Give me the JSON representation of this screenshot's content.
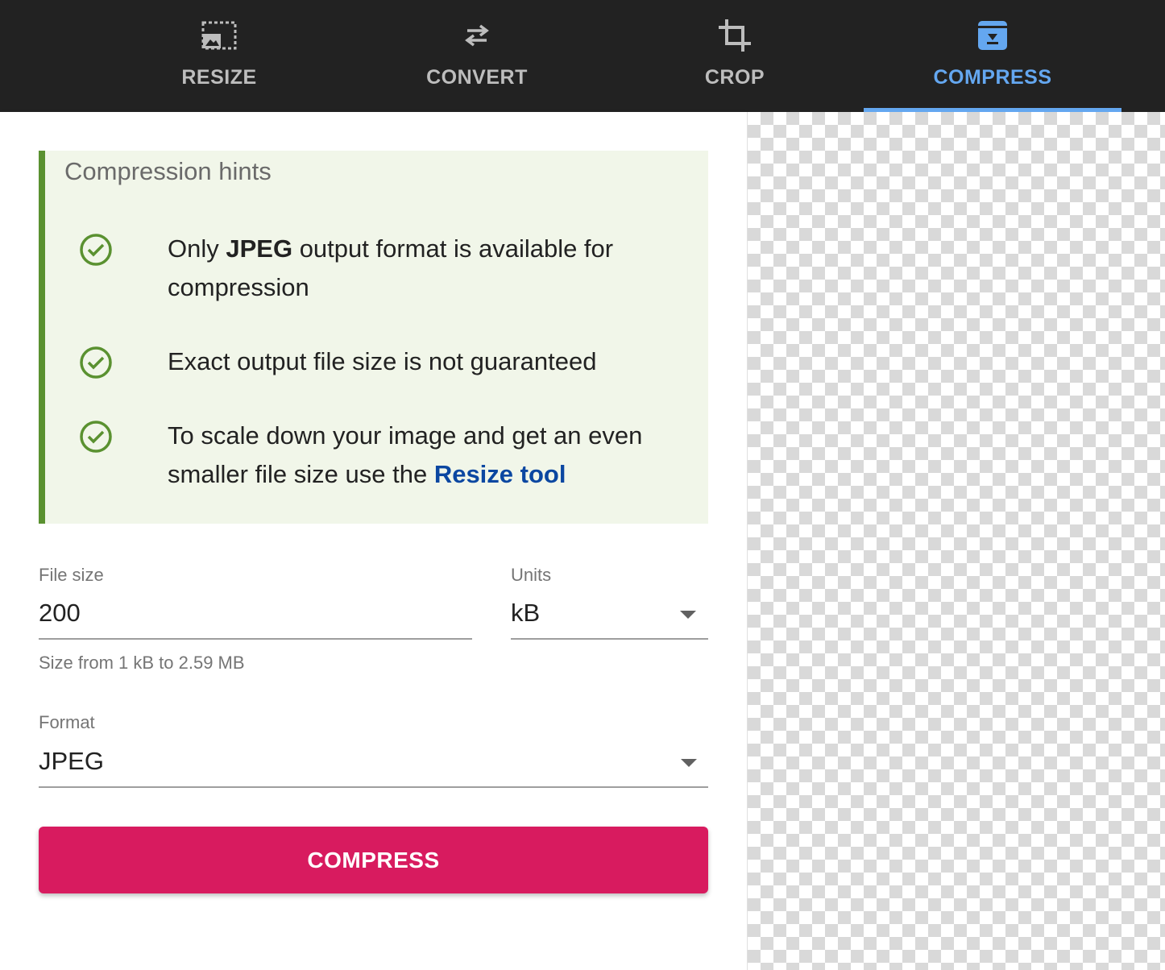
{
  "nav": {
    "tabs": [
      {
        "label": "RESIZE",
        "icon": "image-resize-icon",
        "active": false
      },
      {
        "label": "CONVERT",
        "icon": "swap-arrows-icon",
        "active": false
      },
      {
        "label": "CROP",
        "icon": "crop-icon",
        "active": false
      },
      {
        "label": "COMPRESS",
        "icon": "archive-download-icon",
        "active": true
      }
    ]
  },
  "hints": {
    "title": "Compression hints",
    "items": [
      {
        "icon": "check-circle-icon",
        "pre": "Only ",
        "bold": "JPEG",
        "post": " output format is available for compression"
      },
      {
        "icon": "check-circle-icon",
        "text": "Exact output file size is not guaranteed"
      },
      {
        "icon": "check-circle-icon",
        "pre": "To scale down your image and get an even smaller file size use the ",
        "link": "Resize tool"
      }
    ]
  },
  "form": {
    "file_size": {
      "label": "File size",
      "value": "200",
      "helper": "Size from 1 kB to 2.59 MB"
    },
    "units": {
      "label": "Units",
      "value": "kB"
    },
    "format": {
      "label": "Format",
      "value": "JPEG"
    },
    "submit_label": "COMPRESS"
  },
  "colors": {
    "topbar": "#222222",
    "active_tab": "#64a7f0",
    "hint_bg": "#f1f6e9",
    "hint_accent": "#5a9130",
    "link": "#0b47a1",
    "button": "#d81b5f"
  }
}
